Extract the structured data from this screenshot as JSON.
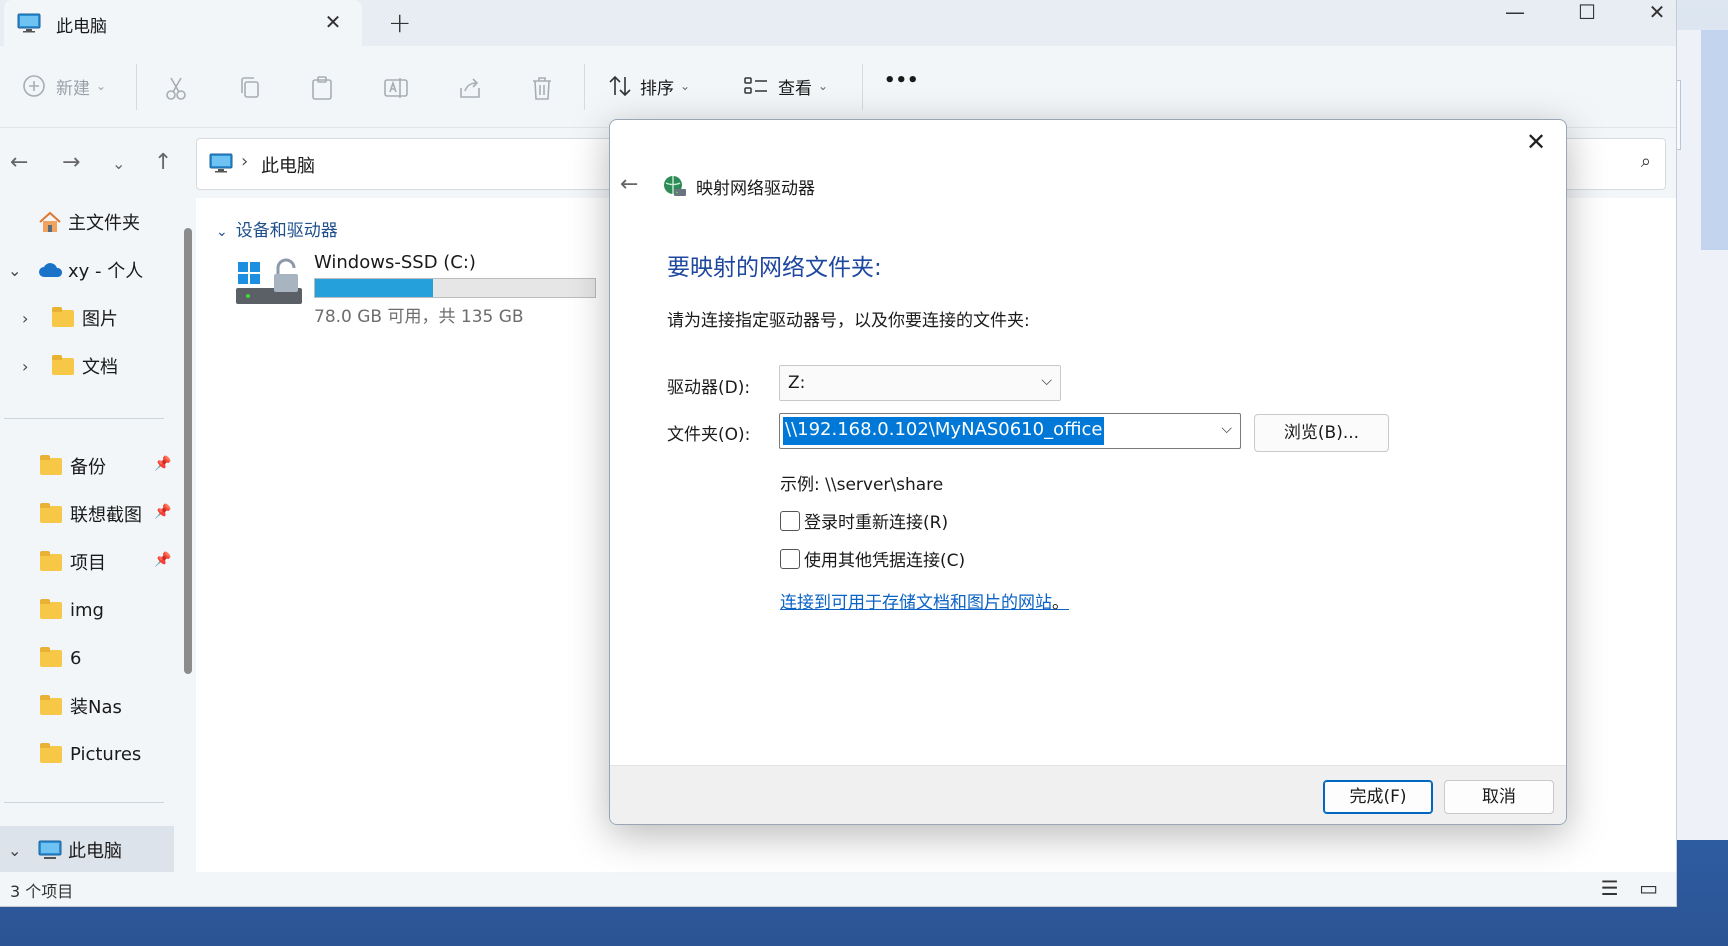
{
  "explorer": {
    "tab_title": "此电脑",
    "toolbar": {
      "new_label": "新建",
      "sort_label": "排序",
      "view_label": "查看",
      "more_label": "•••"
    },
    "address": {
      "path": "此电脑"
    },
    "sidebar": {
      "home": "主文件夹",
      "onedrive": "xy - 个人",
      "pictures": "图片",
      "documents": "文档",
      "pinned": [
        "备份",
        "联想截图",
        "项目",
        "img",
        "6",
        "装Nas",
        "Pictures"
      ],
      "this_pc": "此电脑"
    },
    "content": {
      "group_header": "设备和驱动器",
      "drive_name": "Windows-SSD (C:)",
      "drive_free": "78.0 GB 可用，共 135 GB",
      "drive_used_fraction": 0.42
    },
    "status": "3 个项目"
  },
  "dialog": {
    "title": "映射网络驱动器",
    "heading": "要映射的网络文件夹:",
    "description": "请为连接指定驱动器号，以及你要连接的文件夹:",
    "drive_label": "驱动器(D):",
    "drive_value": "Z:",
    "folder_label": "文件夹(O):",
    "folder_value": "\\\\192.168.0.102\\MyNAS0610_office",
    "browse_label": "浏览(B)...",
    "example": "示例: \\\\server\\share",
    "reconnect_label": "登录时重新连接(R)",
    "reconnect_checked": false,
    "credentials_label": "使用其他凭据连接(C)",
    "credentials_checked": false,
    "link_text": "连接到可用于存储文档和图片的网站",
    "link_suffix": "。",
    "finish_label": "完成(F)",
    "cancel_label": "取消"
  },
  "colors": {
    "accent": "#0078d7",
    "heading": "#1e47a0",
    "link": "#0b63c4",
    "drive_bar": "#26a0da"
  }
}
